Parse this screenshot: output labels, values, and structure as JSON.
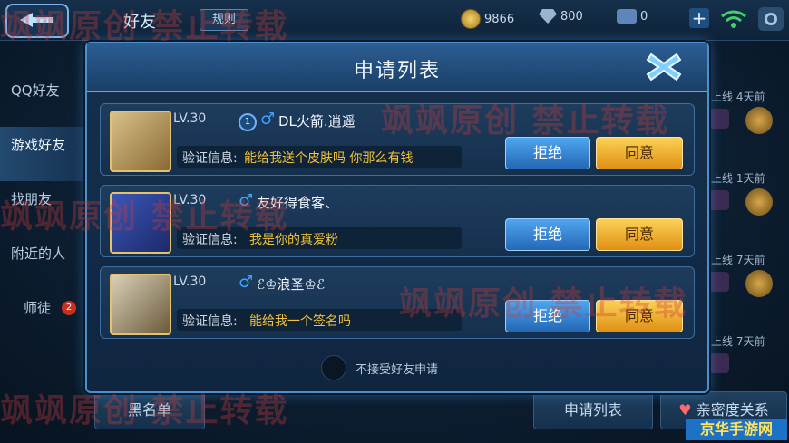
{
  "topbar": {
    "title": "好友",
    "rules_label": "规则",
    "coins": "9866",
    "gems": "800",
    "tickets": "0",
    "plus": "+"
  },
  "sidebar": {
    "items": [
      {
        "label": "QQ好友"
      },
      {
        "label": "游戏好友"
      },
      {
        "label": "找朋友"
      },
      {
        "label": "附近的人"
      },
      {
        "label": "师徒",
        "badge": "2"
      }
    ]
  },
  "right_list": [
    {
      "text": "上线  4天前"
    },
    {
      "text": "上线  1天前"
    },
    {
      "text": "上线  7天前"
    },
    {
      "text": "上线  7天前"
    }
  ],
  "bottom": {
    "blacklist": "黑名单",
    "requests": "申请列表",
    "intimacy": "亲密度关系"
  },
  "modal": {
    "title": "申请列表",
    "verify_label": "验证信息:",
    "reject_label": "拒绝",
    "accept_label": "同意",
    "requests": [
      {
        "level": "LV.30",
        "rank": "1",
        "gender": "♂",
        "name": "DL火箭.逍遥",
        "message": "能给我送个皮肤吗  你那么有钱"
      },
      {
        "level": "LV.30",
        "gender": "♂",
        "name": "友好得食客、",
        "message": "我是你的真爱粉"
      },
      {
        "level": "LV.30",
        "gender": "♂",
        "name": "ℰ♔浪圣♔ℰ",
        "message": "能给我一个签名吗"
      }
    ],
    "toggle_label": "不接受好友申请"
  },
  "watermarks": {
    "text_a": "飒飒原创",
    "text_b": "禁止转载",
    "text_c": "飒飒原创 禁止转载"
  },
  "brand": "京华手游网",
  "colors": {
    "accent_blue": "#4b8fcf",
    "accept_orange": "#e08f13",
    "reject_blue": "#2467b5",
    "message_yellow": "#f1c23a"
  }
}
